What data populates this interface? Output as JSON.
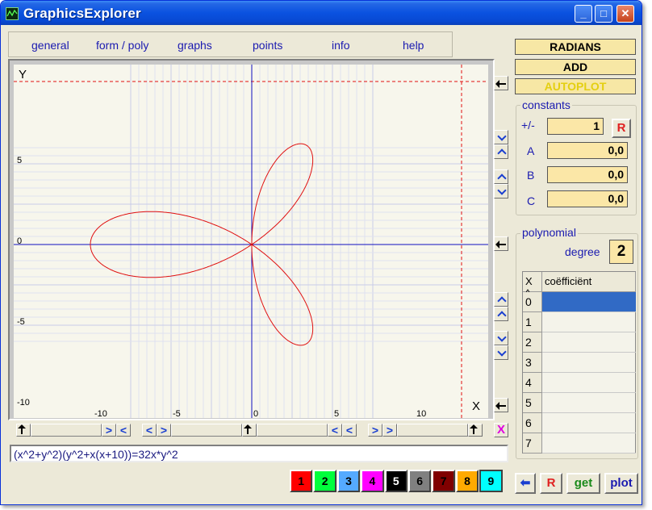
{
  "window": {
    "title": "GraphicsExplorer"
  },
  "menu": [
    "general",
    "form / poly",
    "graphs",
    "points",
    "info",
    "help"
  ],
  "plot": {
    "y_axis_label": "Y",
    "x_axis_label": "X",
    "x_ticks": [
      "-10",
      "-5",
      "0",
      "5",
      "10"
    ],
    "y_ticks": [
      "5",
      "0",
      "-5",
      "-10"
    ],
    "curve_color": "#e01010",
    "axis_color": "#1010c0",
    "marker_color": "#e01010"
  },
  "formula": "(x^2+y^2)(y^2+x(x+10))=32x*y^2",
  "color_buttons": [
    {
      "label": "1",
      "bg": "#ff0000",
      "fg": "#000000"
    },
    {
      "label": "2",
      "bg": "#00ff3c",
      "fg": "#000000"
    },
    {
      "label": "3",
      "bg": "#55aaff",
      "fg": "#000000"
    },
    {
      "label": "4",
      "bg": "#ff00ff",
      "fg": "#000000"
    },
    {
      "label": "5",
      "bg": "#000000",
      "fg": "#ffffff"
    },
    {
      "label": "6",
      "bg": "#808080",
      "fg": "#000000"
    },
    {
      "label": "7",
      "bg": "#800000",
      "fg": "#000000"
    },
    {
      "label": "8",
      "bg": "#ffaa00",
      "fg": "#000000"
    },
    {
      "label": "9",
      "bg": "#00ffff",
      "fg": "#000000"
    }
  ],
  "toggles": {
    "radians": "RADIANS",
    "add": "ADD",
    "autoplot": "AUTOPLOT"
  },
  "constants": {
    "title": "constants",
    "rows": [
      {
        "label": "+/-",
        "value": "1"
      },
      {
        "label": "A",
        "value": "0,0"
      },
      {
        "label": "B",
        "value": "0,0"
      },
      {
        "label": "C",
        "value": "0,0"
      }
    ],
    "reset": "R"
  },
  "polynomial": {
    "title": "polynomial",
    "degree_label": "degree",
    "degree": "2",
    "col_x": "X ^",
    "col_coef": "coëfficiënt",
    "rows": [
      "0",
      "1",
      "2",
      "3",
      "4",
      "5",
      "6",
      "7"
    ]
  },
  "bottom": {
    "reset": "R",
    "get": "get",
    "plot": "plot"
  },
  "clear_x": "X"
}
